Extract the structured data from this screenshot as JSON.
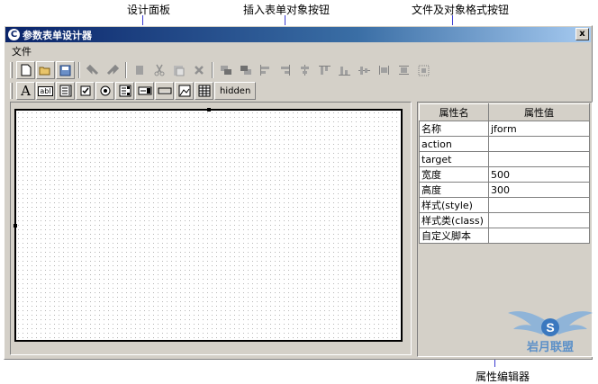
{
  "annotations": {
    "design_panel": "设计面板",
    "insert_buttons": "插入表单对象按钮",
    "format_buttons": "文件及对象格式按钮",
    "property_editor": "属性编辑器"
  },
  "window": {
    "title": "参数表单设计器",
    "close_label": "x"
  },
  "menu": {
    "items": [
      "文件"
    ]
  },
  "toolbar1": {
    "buttons": [
      "new-file-icon",
      "open-folder-icon",
      "save-icon",
      "undo-icon",
      "redo-icon",
      "copy-icon",
      "cut-icon",
      "paste-icon",
      "delete-icon",
      "bring-front-icon",
      "send-back-icon",
      "align-left-icon",
      "align-right-icon",
      "align-center-icon",
      "align-top-icon",
      "align-bottom-icon",
      "align-middle-icon",
      "same-width-icon",
      "same-height-icon",
      "same-size-icon"
    ]
  },
  "toolbar2": {
    "label_glyph": "A",
    "textbox_glyph": "abl",
    "hidden_label": "hidden"
  },
  "properties": {
    "header": {
      "name": "属性名",
      "value": "属性值"
    },
    "rows": [
      {
        "name": "名称",
        "value": "jform"
      },
      {
        "name": "action",
        "value": ""
      },
      {
        "name": "target",
        "value": ""
      },
      {
        "name": "宽度",
        "value": "500"
      },
      {
        "name": "高度",
        "value": "300"
      },
      {
        "name": "样式(style)",
        "value": ""
      },
      {
        "name": "样式类(class)",
        "value": ""
      },
      {
        "name": "自定义脚本",
        "value": ""
      }
    ]
  },
  "logo": {
    "text": "岩月联盟",
    "mark": "S"
  },
  "colors": {
    "titlebar_start": "#0a246a",
    "titlebar_end": "#a6caf0",
    "face": "#d4d0c8",
    "callout_line": "#3b3bd1"
  }
}
